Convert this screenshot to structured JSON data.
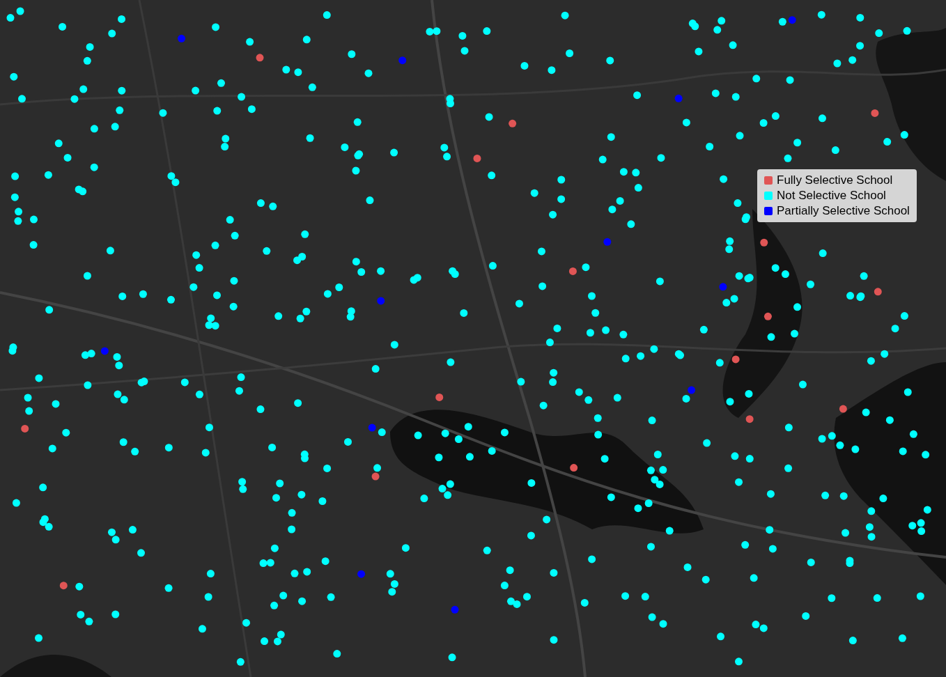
{
  "legend": {
    "items": [
      {
        "label": "Fully Selective School",
        "color": "#e05555"
      },
      {
        "label": "Not Selective School",
        "color": "#00ffff"
      },
      {
        "label": "Partially Selective School",
        "color": "#0000ff"
      }
    ]
  }
}
